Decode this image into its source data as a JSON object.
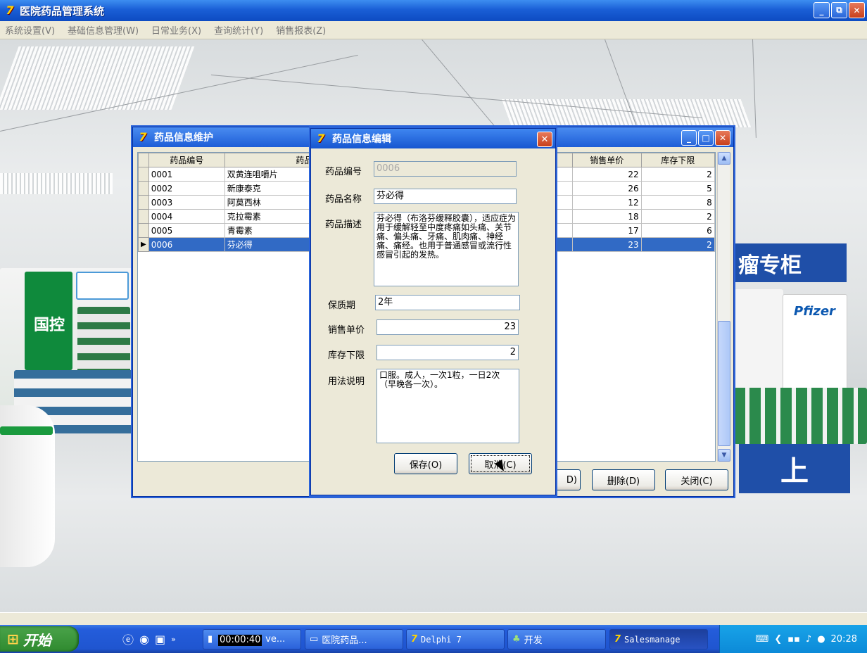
{
  "app": {
    "title": "医院药品管理系统",
    "icon": "delphi-icon",
    "win_buttons": {
      "min": "_",
      "max": "⧉",
      "close": "✕"
    }
  },
  "menu": [
    "系统设置(V)",
    "基础信息管理(W)",
    "日常业务(X)",
    "查询统计(Y)",
    "销售报表(Z)"
  ],
  "background": {
    "sign_text": "瘤专柜",
    "brand": "Pfizer",
    "brand2": "国控",
    "brand3": "上"
  },
  "main_window": {
    "title": "药品信息维护",
    "columns": [
      "药品编号",
      "药品名称",
      "",
      "销售单价",
      "库存下限"
    ],
    "rows": [
      {
        "id": "0001",
        "name": "双黄连咀嚼片",
        "price": "22",
        "min": "2"
      },
      {
        "id": "0002",
        "name": "新康泰克",
        "price": "26",
        "min": "5"
      },
      {
        "id": "0003",
        "name": "阿莫西林",
        "price": "12",
        "min": "8"
      },
      {
        "id": "0004",
        "name": "克拉霉素",
        "price": "18",
        "min": "2"
      },
      {
        "id": "0005",
        "name": "青霉素",
        "price": "17",
        "min": "6"
      },
      {
        "id": "0006",
        "name": "芬必得",
        "price": "23",
        "min": "2"
      }
    ],
    "selected_index": 5,
    "btn_partial": "D)",
    "btn_delete": "删除(D)",
    "btn_close": "关闭(C)"
  },
  "dialog": {
    "title": "药品信息编辑",
    "close": "✕",
    "labels": {
      "code": "药品编号",
      "name": "药品名称",
      "desc": "药品描述",
      "shelf": "保质期",
      "price": "销售单价",
      "min": "库存下限",
      "usage": "用法说明"
    },
    "values": {
      "code": "0006",
      "name": "芬必得",
      "desc": "芬必得（布洛芬缓释胶囊），适应症为用于缓解轻至中度疼痛如头痛、关节痛、偏头痛、牙痛、肌肉痛、神经痛、痛经。也用于普通感冒或流行性感冒引起的发热。",
      "shelf": "2年",
      "price": "23",
      "min": "2",
      "usage": "口服。成人，一次1粒，一日2次（早晚各一次）。"
    },
    "btn_save": "保存(O)",
    "btn_cancel": "取消(C)"
  },
  "taskbar": {
    "start": "开始",
    "timer": "00:00:40",
    "tasks": [
      "ve...",
      "医院药品...",
      "Delphi 7",
      "开发",
      "Salesmanage"
    ],
    "clock": "20:28"
  }
}
